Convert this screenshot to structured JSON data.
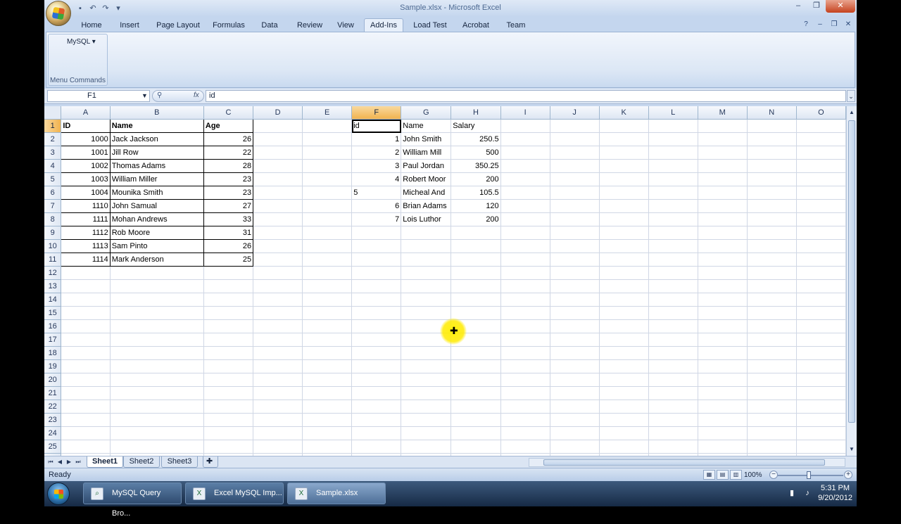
{
  "window": {
    "title": "Sample.xlsx - Microsoft Excel",
    "qat_icons": [
      "save-icon",
      "undo-icon",
      "redo-icon",
      "customize-icon"
    ]
  },
  "tabs": [
    {
      "label": "Home",
      "active": false
    },
    {
      "label": "Insert",
      "active": false
    },
    {
      "label": "Page Layout",
      "active": false
    },
    {
      "label": "Formulas",
      "active": false
    },
    {
      "label": "Data",
      "active": false
    },
    {
      "label": "Review",
      "active": false
    },
    {
      "label": "View",
      "active": false
    },
    {
      "label": "Add-Ins",
      "active": true
    },
    {
      "label": "Load Test",
      "active": false
    },
    {
      "label": "Acrobat",
      "active": false
    },
    {
      "label": "Team",
      "active": false
    }
  ],
  "ribbon": {
    "mysql_label": "MySQL",
    "group_label": "Menu Commands"
  },
  "formula_bar": {
    "name_box": "F1",
    "fx_label": "fx",
    "value": "id"
  },
  "sheet": {
    "columns": [
      "A",
      "B",
      "C",
      "D",
      "E",
      "F",
      "G",
      "H",
      "I",
      "J",
      "K",
      "L",
      "M",
      "N",
      "O"
    ],
    "selected_column": "F",
    "selected_row": 1,
    "row_count": 26,
    "table1": {
      "headers": [
        "ID",
        "Name",
        "Age"
      ],
      "rows": [
        [
          "1000",
          "Jack Jackson",
          "26"
        ],
        [
          "1001",
          "Jill Row",
          "22"
        ],
        [
          "1002",
          "Thomas Adams",
          "28"
        ],
        [
          "1003",
          "William Miller",
          "23"
        ],
        [
          "1004",
          "Mounika Smith",
          "23"
        ],
        [
          "1110",
          "John Samual",
          "27"
        ],
        [
          "1111",
          "Mohan Andrews",
          "33"
        ],
        [
          "1112",
          "Rob Moore",
          "31"
        ],
        [
          "1113",
          "Sam Pinto",
          "26"
        ],
        [
          "1114",
          "Mark Anderson",
          "25"
        ]
      ]
    },
    "table2": {
      "headers": [
        "id",
        "Name",
        "Salary"
      ],
      "rows": [
        [
          "1",
          "John Smith",
          "250.5"
        ],
        [
          "2",
          "William Mill",
          "500"
        ],
        [
          "3",
          "Paul Jordan",
          "350.25"
        ],
        [
          "4",
          "Robert Moor",
          "200"
        ],
        [
          "5",
          "Micheal And",
          "105.5"
        ],
        [
          "6",
          "Brian Adams",
          "120"
        ],
        [
          "7",
          "Lois Luthor",
          "200"
        ]
      ]
    }
  },
  "sheet_tabs": [
    {
      "label": "Sheet1",
      "active": true
    },
    {
      "label": "Sheet2",
      "active": false
    },
    {
      "label": "Sheet3",
      "active": false
    }
  ],
  "status": {
    "text": "Ready",
    "zoom": "100%"
  },
  "taskbar": {
    "items": [
      {
        "label": "MySQL Query Bro...",
        "active": false
      },
      {
        "label": "Excel MySQL Imp...",
        "active": false
      },
      {
        "label": "Sample.xlsx",
        "active": true
      }
    ],
    "time": "5:31 PM",
    "date": "9/20/2012"
  }
}
